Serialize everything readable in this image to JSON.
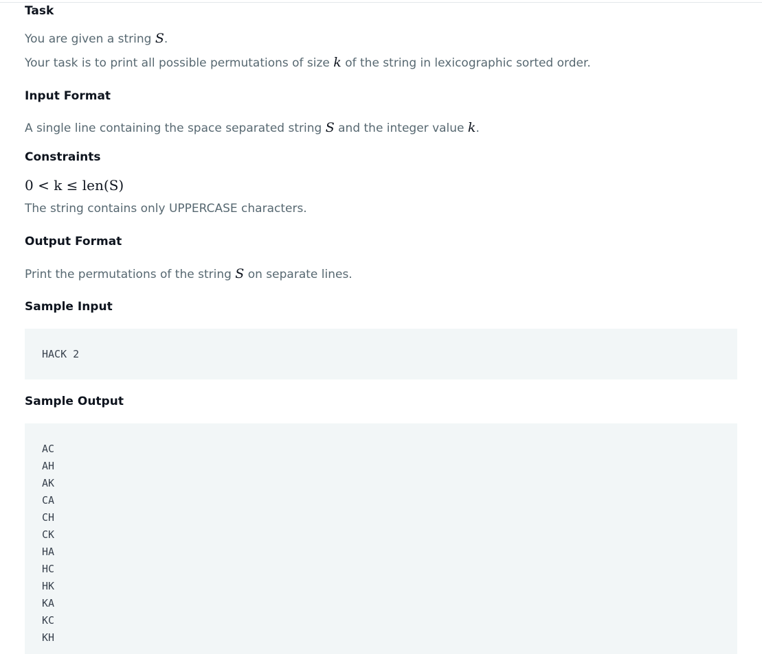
{
  "task": {
    "heading": "Task",
    "line1_before": "You are given a string ",
    "line1_var": "S",
    "line1_after": ".",
    "line2_before": "Your task is to print all possible permutations of size ",
    "line2_var": "k",
    "line2_after": " of the string in lexicographic sorted order."
  },
  "input_format": {
    "heading": "Input Format",
    "text_before": "A single line containing the space separated string ",
    "var1": "S",
    "text_middle": " and the integer value ",
    "var2": "k",
    "text_after": "."
  },
  "constraints": {
    "heading": "Constraints",
    "math": "0 < k ≤ len(S)",
    "text": "The string contains only UPPERCASE characters."
  },
  "output_format": {
    "heading": "Output Format",
    "text_before": "Print the permutations of the string ",
    "var": "S",
    "text_after": " on separate lines."
  },
  "sample_input": {
    "heading": "Sample Input",
    "lines": [
      "HACK 2"
    ]
  },
  "sample_output": {
    "heading": "Sample Output",
    "lines": [
      "AC",
      "AH",
      "AK",
      "CA",
      "CH",
      "CK",
      "HA",
      "HC",
      "HK",
      "KA",
      "KC",
      "KH"
    ]
  }
}
